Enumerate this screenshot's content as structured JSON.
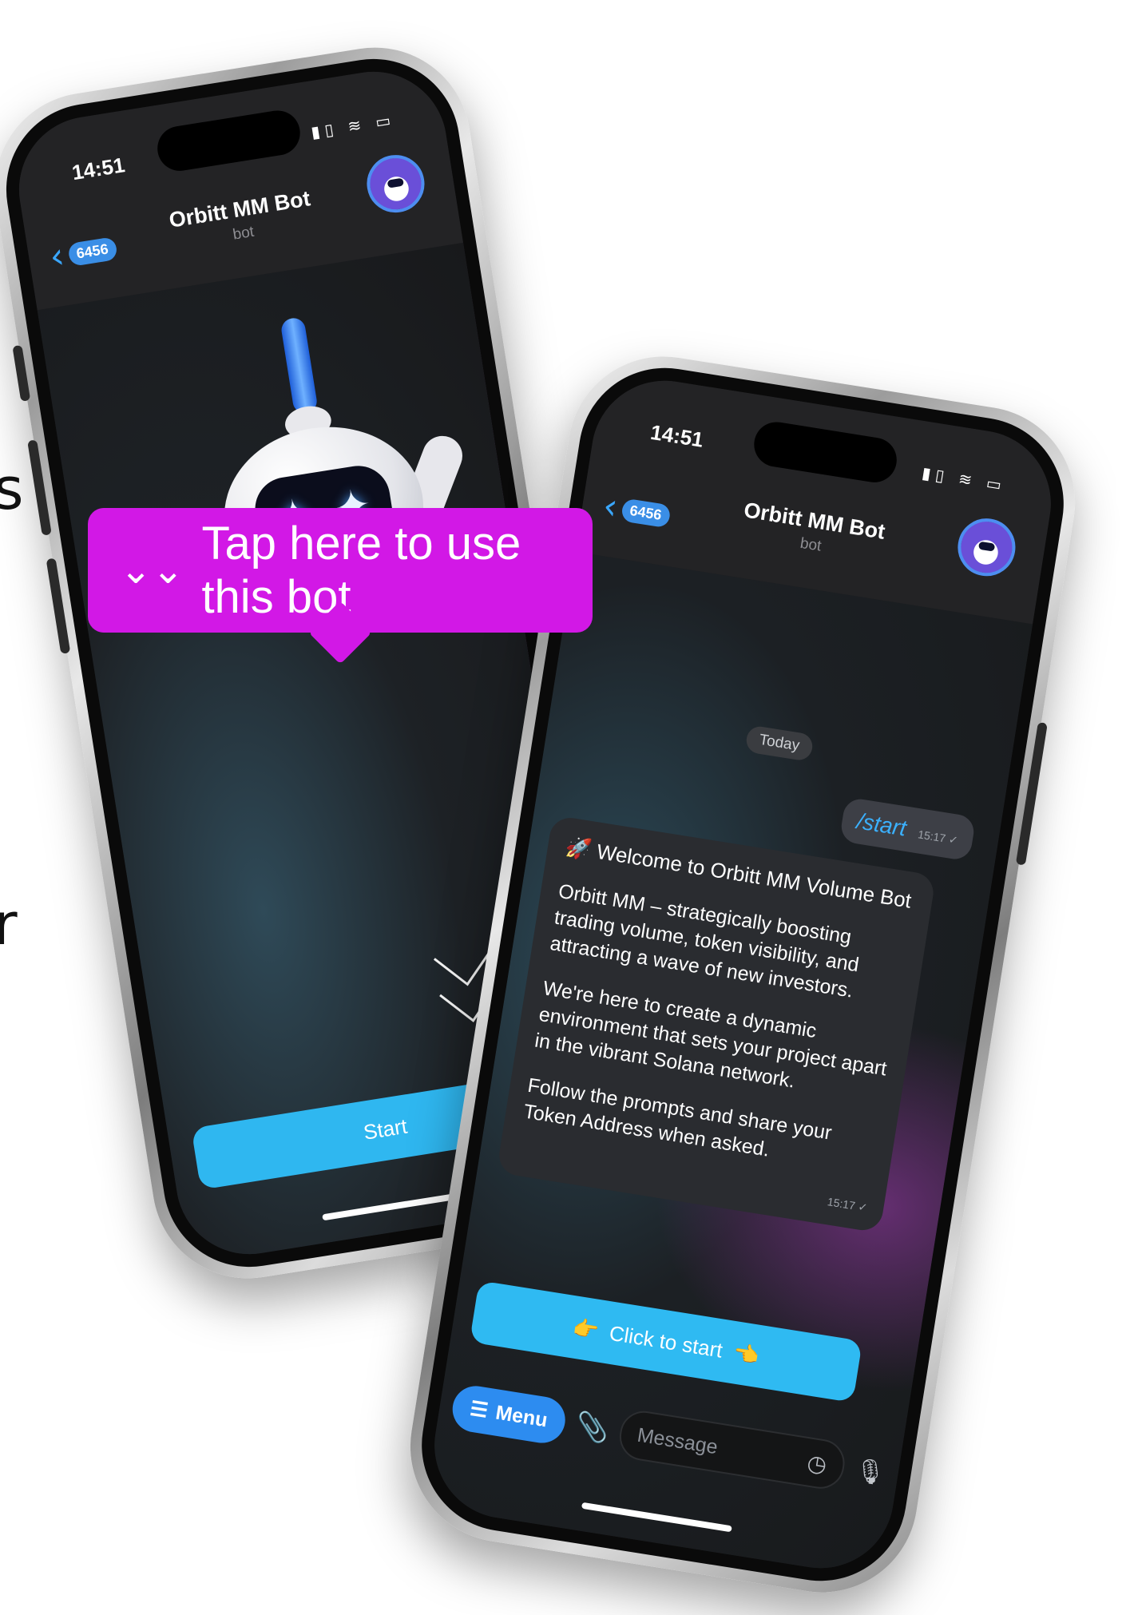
{
  "edge_text": {
    "top": "s",
    "bottom": "r"
  },
  "left_phone": {
    "time": "14:51",
    "status_icons": "▮▯ ≋ ▭",
    "back_count": "6456",
    "title": "Orbitt MM Bot",
    "subtitle": "bot",
    "start_button": "Start"
  },
  "tooltip": {
    "icon": "⌄⌄",
    "text": "Tap here to use this bot"
  },
  "right_phone": {
    "time": "14:51",
    "status_icons": "▮▯ ≋ ▭",
    "back_count": "6456",
    "title": "Orbitt MM Bot",
    "subtitle": "bot",
    "date_chip": "Today",
    "outgoing": {
      "text": "/start",
      "time": "15:17 ✓"
    },
    "incoming": {
      "heading": "🚀 Welcome to Orbitt MM Volume Bot",
      "p1": "Orbitt MM – strategically boosting trading volume, token visibility, and attracting a wave of new investors.",
      "p2": "We're here to create a dynamic environment that sets your project apart in the vibrant Solana network.",
      "p3": "Follow the prompts and share your Token Address when asked.",
      "time": "15:17 ✓"
    },
    "click_button": {
      "left_emoji": "👉",
      "label": "Click to start",
      "right_emoji": "👈"
    },
    "composer": {
      "menu_label": "Menu",
      "placeholder": "Message"
    }
  },
  "colors": {
    "accent_blue": "#2fb7f0",
    "tooltip_magenta": "#d218e6",
    "menu_blue": "#2d8cf0"
  }
}
